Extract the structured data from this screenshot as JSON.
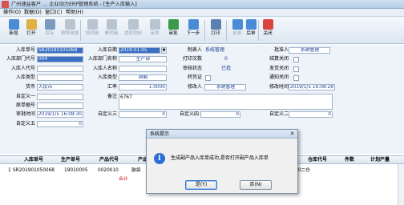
{
  "window": {
    "title": "广州速益客户 … 企业动力ERP管理系统 - [生产入库输入]"
  },
  "menu": [
    {
      "label": "操作(O)"
    },
    {
      "label": "数据(D)"
    },
    {
      "label": "窗口(C)"
    },
    {
      "label": "帮助(H)"
    }
  ],
  "toolbar": [
    {
      "label": "新增",
      "color": "#4a8bd6",
      "disabled": false
    },
    {
      "label": "打开",
      "color": "#e0b040",
      "disabled": false
    },
    {
      "label": "保存",
      "color": "#7a9ac0",
      "disabled": true
    },
    {
      "label": "删除单据",
      "color": "#b8c4d2",
      "disabled": true
    },
    {
      "label": "增明细",
      "color": "#b8c4d2",
      "disabled": true
    },
    {
      "label": "删明细",
      "color": "#b8c4d2",
      "disabled": true
    },
    {
      "label": "提取物料",
      "color": "#b8c4d2",
      "disabled": true
    },
    {
      "label": "审核",
      "color": "#b8c4d2",
      "disabled": true
    },
    {
      "label": "审批",
      "color": "#3a9a4a",
      "disabled": false
    },
    {
      "label": "下一步",
      "color": "#4a8bd6",
      "disabled": false
    },
    {
      "label": "打印",
      "color": "#5a7fb0",
      "disabled": false
    },
    {
      "label": "前单",
      "color": "#4a8bd6",
      "disabled": true
    },
    {
      "label": "后单",
      "color": "#4a8bd6",
      "disabled": false
    },
    {
      "label": "关闭",
      "color": "#d9443c",
      "disabled": false
    }
  ],
  "form": {
    "labels": {
      "doc_no": "入库单号",
      "date": "入库日期",
      "maker": "制表人",
      "approver": "批准人",
      "dept_code": "入库部门代号",
      "dept_name": "入库部门名称",
      "print_count": "打印次数",
      "settle_closed": "结算关闭",
      "person_code": "入库人代号",
      "person_name": "入库人名称",
      "audit_status": "审核状态",
      "invoice_closed": "发货关闭",
      "doc_type": "入库类型",
      "class": "入库类型",
      "transfer": "转凭证",
      "notify_closed": "通知关闭",
      "currency": "货币",
      "rate": "汇率",
      "modifier": "修改人",
      "modify_time": "修改时间",
      "custom1": "自定义一",
      "remark": "备注",
      "original_no": "原单据号",
      "audit_time": "审批时间",
      "custom3": "自定义三",
      "custom4": "自定义四",
      "custom2": "自定义二",
      "custom5": "自定义五"
    },
    "values": {
      "doc_no": "SR20190105068",
      "date": "2019-01-05",
      "maker": "系统管理",
      "approver": "系统管理",
      "dept_code": "004",
      "dept_name": "生产部",
      "print_count": "0",
      "audit_status": "已批",
      "class": "自制",
      "currency": "人民币",
      "rate": "1.0000",
      "modifier": "系统管理",
      "modify_time": "2019/1/5 16:08:28",
      "remark": "6767",
      "audit_time": "2019/1/5 16:08:30",
      "custom3": "0",
      "custom4": "0",
      "custom2": "0",
      "custom5": "0"
    },
    "dropdown_glyph": "▼"
  },
  "grid": {
    "headers": [
      "入库单号",
      "生产单号",
      "产品代号",
      "产品",
      "仓库代号",
      "件数",
      "计划产量"
    ],
    "rows": [
      {
        "no": "1",
        "doc_no": "SR201901050068",
        "prod_no": "19010005",
        "code": "0020010",
        "product": "鼓袋",
        "wh": "00二仓",
        "qty": ""
      }
    ],
    "total_label": "合计"
  },
  "dialog": {
    "title": "系统提示",
    "message": "生成副产品入库单成功,是否打开副产品入库单",
    "icon": "i",
    "yes": "是(Y)",
    "no": "否(N)",
    "close": "✕"
  }
}
